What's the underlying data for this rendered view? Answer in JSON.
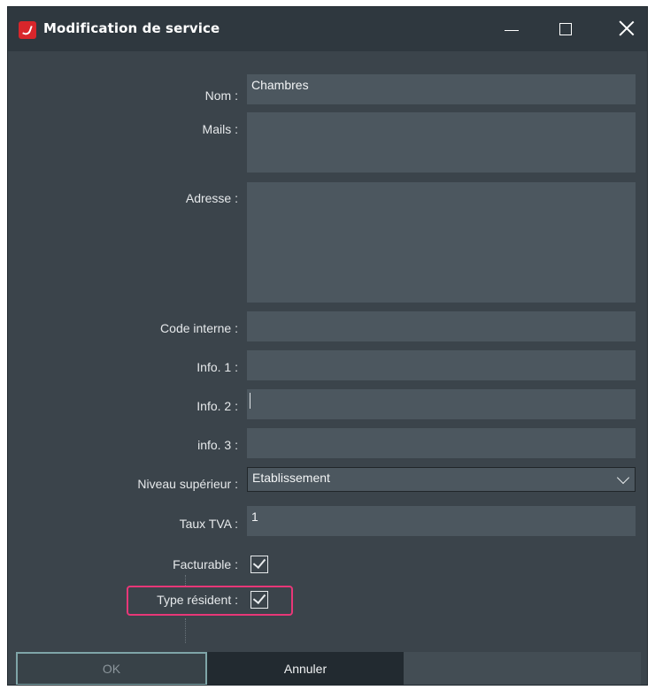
{
  "window": {
    "title": "Modification de service",
    "icon": "app-logo-icon",
    "controls": [
      "minimize-icon",
      "maximize-icon",
      "close-icon"
    ]
  },
  "form": {
    "nom": {
      "label": "Nom :",
      "value": "Chambres"
    },
    "mails": {
      "label": "Mails :",
      "value": ""
    },
    "adresse": {
      "label": "Adresse :",
      "value": ""
    },
    "code_interne": {
      "label": "Code interne :",
      "value": ""
    },
    "info1": {
      "label": "Info. 1 :",
      "value": ""
    },
    "info2": {
      "label": "Info. 2 :",
      "value": ""
    },
    "info3": {
      "label": "info. 3 :",
      "value": ""
    },
    "niveau_superieur": {
      "label": "Niveau supérieur :",
      "value": "Etablissement"
    },
    "taux_tva": {
      "label": "Taux TVA :",
      "value": "1"
    },
    "facturable": {
      "label": "Facturable :",
      "checked": true
    },
    "type_resident": {
      "label": "Type résident :",
      "checked": true
    }
  },
  "footer": {
    "ok_label": "OK",
    "cancel_label": "Annuler"
  },
  "colors": {
    "background": "#3b444b",
    "field": "#4c575f",
    "titlebar": "#2f383f",
    "highlight": "#e83778",
    "ok_border": "#7fa5a8"
  }
}
